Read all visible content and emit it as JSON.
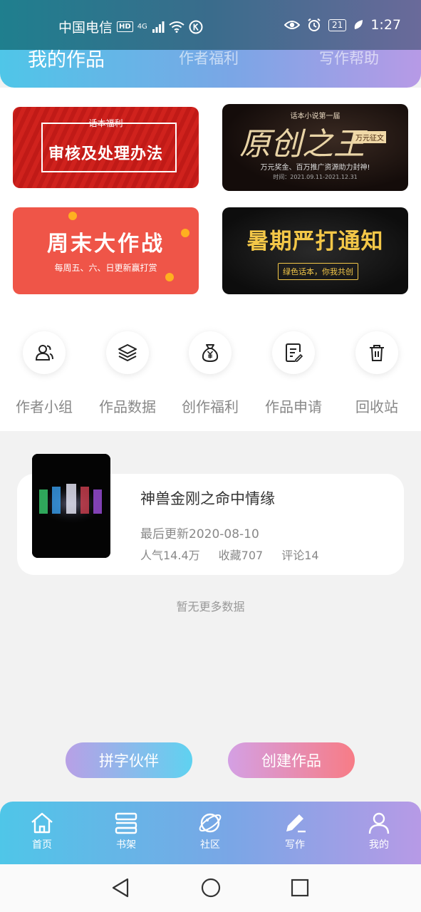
{
  "status_bar": {
    "carrier": "中国电信",
    "hd_badge": "HD",
    "signal_type": "4G",
    "battery": "21",
    "time": "1:27"
  },
  "header": {
    "tabs": [
      {
        "label": "我的作品",
        "active": true
      },
      {
        "label": "作者福利",
        "active": false
      },
      {
        "label": "写作帮助",
        "active": false
      }
    ]
  },
  "banners": [
    {
      "small": "话本福利",
      "title": "审核及处理办法"
    },
    {
      "small": "话本小说第一届",
      "title": "原创之王",
      "tag": "万元征文",
      "line1": "万元奖金、百万推广资源助力封神!",
      "line2": "时间：2021.09.11-2021.12.31"
    },
    {
      "title": "周末大作战",
      "subtitle": "每周五、六、日更新赢打赏"
    },
    {
      "title": "暑期严打通知",
      "subtitle": "绿色话本，你我共创"
    }
  ],
  "shortcuts": [
    {
      "label": "作者小组",
      "icon": "users-icon"
    },
    {
      "label": "作品数据",
      "icon": "layers-icon"
    },
    {
      "label": "创作福利",
      "icon": "money-bag-icon"
    },
    {
      "label": "作品申请",
      "icon": "document-edit-icon"
    },
    {
      "label": "回收站",
      "icon": "trash-icon"
    }
  ],
  "work": {
    "title": "神兽金刚之命中情缘",
    "updated": "最后更新2020-08-10",
    "popularity": "人气14.4万",
    "favorites": "收藏707",
    "comments": "评论14"
  },
  "no_more": "暂无更多数据",
  "buttons": {
    "partner": "拼字伙伴",
    "create": "创建作品"
  },
  "bottom_tabs": [
    {
      "label": "首页",
      "icon": "home-icon"
    },
    {
      "label": "书架",
      "icon": "bookshelf-icon"
    },
    {
      "label": "社区",
      "icon": "planet-icon"
    },
    {
      "label": "写作",
      "icon": "pen-icon"
    },
    {
      "label": "我的",
      "icon": "user-icon"
    }
  ],
  "colors": {
    "brand_gradient_start": "#4fc6e8",
    "brand_gradient_end": "#b79ae6",
    "create_button_end": "#f77c86"
  }
}
